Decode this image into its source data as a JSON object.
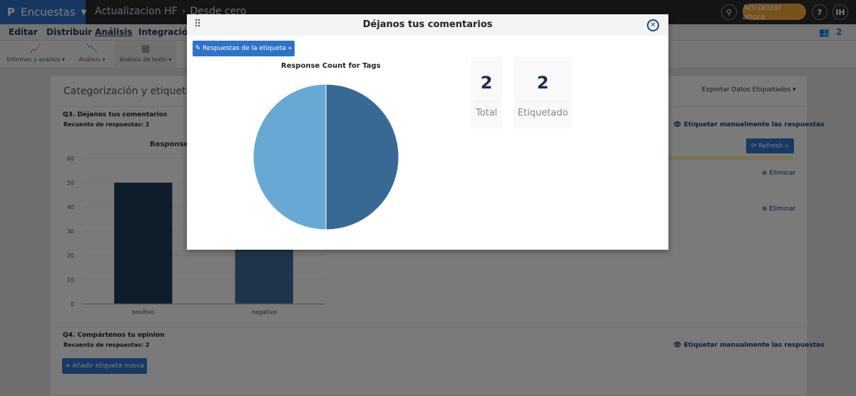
{
  "header": {
    "brand": "Encuestas",
    "breadcrumb": [
      "Actualizacion HF",
      "Desde cero"
    ],
    "update_button": "Actualizar ahora",
    "help": "?",
    "user_initials": "IH"
  },
  "menu": [
    "Editar",
    "Distribuir",
    "Análisis",
    "Integración"
  ],
  "collaborators_count": "2",
  "toolbar": [
    "Informes y análisis",
    "Análisis",
    "Análisis de texto"
  ],
  "page": {
    "title": "Categorización y etiquetado de texto",
    "export": "Exportar Datos Etiquetados",
    "q3": {
      "title": "Q3. Déjanos tus comentarios",
      "count": "Recuento de respuestas: 2",
      "manual": "Etiquetar manualmente las respuestas",
      "refresh": "Refresh »",
      "delete": "Eliminar"
    },
    "q4": {
      "title": "Q4. Compártenos tu opinion",
      "count": "Recuento de respuestas: 2",
      "manual": "Etiquetar manualmente las respuestas"
    },
    "add_tag": "Añadir etiqueta nueva"
  },
  "modal": {
    "title": "Déjanos tus comentarios",
    "tag_button": "Respuestas de la etiqueta »",
    "stats": [
      {
        "value": "2",
        "label": "Total"
      },
      {
        "value": "2",
        "label": "Etiquetado"
      }
    ]
  },
  "chart_data": [
    {
      "type": "bar",
      "title": "Response Count for Tags",
      "categories": [
        "positivo",
        "negativo"
      ],
      "values": [
        50,
        50
      ],
      "ylim": [
        0,
        60
      ],
      "yticks": [
        0,
        10,
        20,
        30,
        40,
        50,
        60
      ],
      "colors": [
        "#1e3a56",
        "#3f6c94"
      ]
    },
    {
      "type": "pie",
      "title": "Response Count for Tags",
      "categories": [
        "positivo",
        "negativo"
      ],
      "values": [
        1,
        1
      ],
      "colors": [
        "#386994",
        "#68a8d4"
      ]
    }
  ]
}
